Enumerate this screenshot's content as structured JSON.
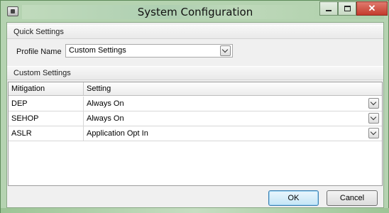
{
  "window": {
    "title": "System Configuration"
  },
  "quick_settings": {
    "header": "Quick Settings",
    "profile_label": "Profile Name",
    "profile_value": "Custom Settings"
  },
  "custom_settings": {
    "header": "Custom Settings",
    "columns": [
      "Mitigation",
      "Setting"
    ],
    "rows": [
      {
        "mitigation": "DEP",
        "setting": "Always On"
      },
      {
        "mitigation": "SEHOP",
        "setting": "Always On"
      },
      {
        "mitigation": "ASLR",
        "setting": "Application Opt In"
      }
    ]
  },
  "buttons": {
    "ok": "OK",
    "cancel": "Cancel"
  },
  "icons": {
    "app": "app-icon",
    "minimize": "minimize-icon",
    "maximize": "maximize-icon",
    "close": "close-icon",
    "dropdown": "chevron-down-icon"
  },
  "colors": {
    "close_button": "#c43b2c",
    "default_button_border": "#3c7fb1"
  }
}
